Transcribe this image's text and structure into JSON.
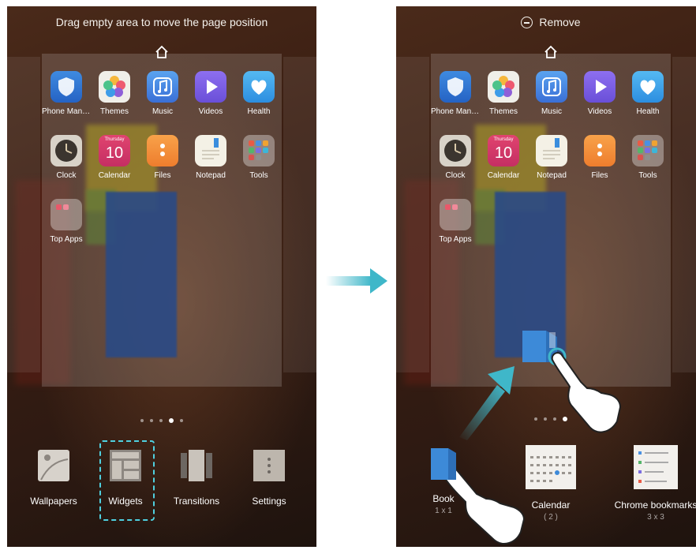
{
  "left_screen": {
    "hint": "Drag empty area to move the page position",
    "apps_row1": [
      "Phone Mana..",
      "Themes",
      "Music",
      "Videos",
      "Health"
    ],
    "apps_row2": [
      "Clock",
      "Calendar",
      "Files",
      "Notepad",
      "Tools"
    ],
    "apps_row3": [
      "Top Apps"
    ],
    "calendar_weekday": "Thursday",
    "calendar_date": "10",
    "toolbar": [
      "Wallpapers",
      "Widgets",
      "Transitions",
      "Settings"
    ]
  },
  "right_screen": {
    "remove_label": "Remove",
    "apps_row1": [
      "Phone Mana..",
      "Themes",
      "Music",
      "Videos",
      "Health"
    ],
    "apps_row2": [
      "Clock",
      "Calendar",
      "Notepad",
      "Files",
      "Tools"
    ],
    "apps_row3": [
      "Top Apps"
    ],
    "calendar_weekday": "Thursday",
    "calendar_date": "10",
    "widgets": [
      {
        "name": "Book",
        "size": "1 x 1"
      },
      {
        "name": "Calendar",
        "size": "( 2 )"
      },
      {
        "name": "Chrome bookmarks",
        "size": "3 x 3"
      }
    ]
  },
  "colors": {
    "accent": "#3fb7c9",
    "selection": "#4fd0e0"
  }
}
